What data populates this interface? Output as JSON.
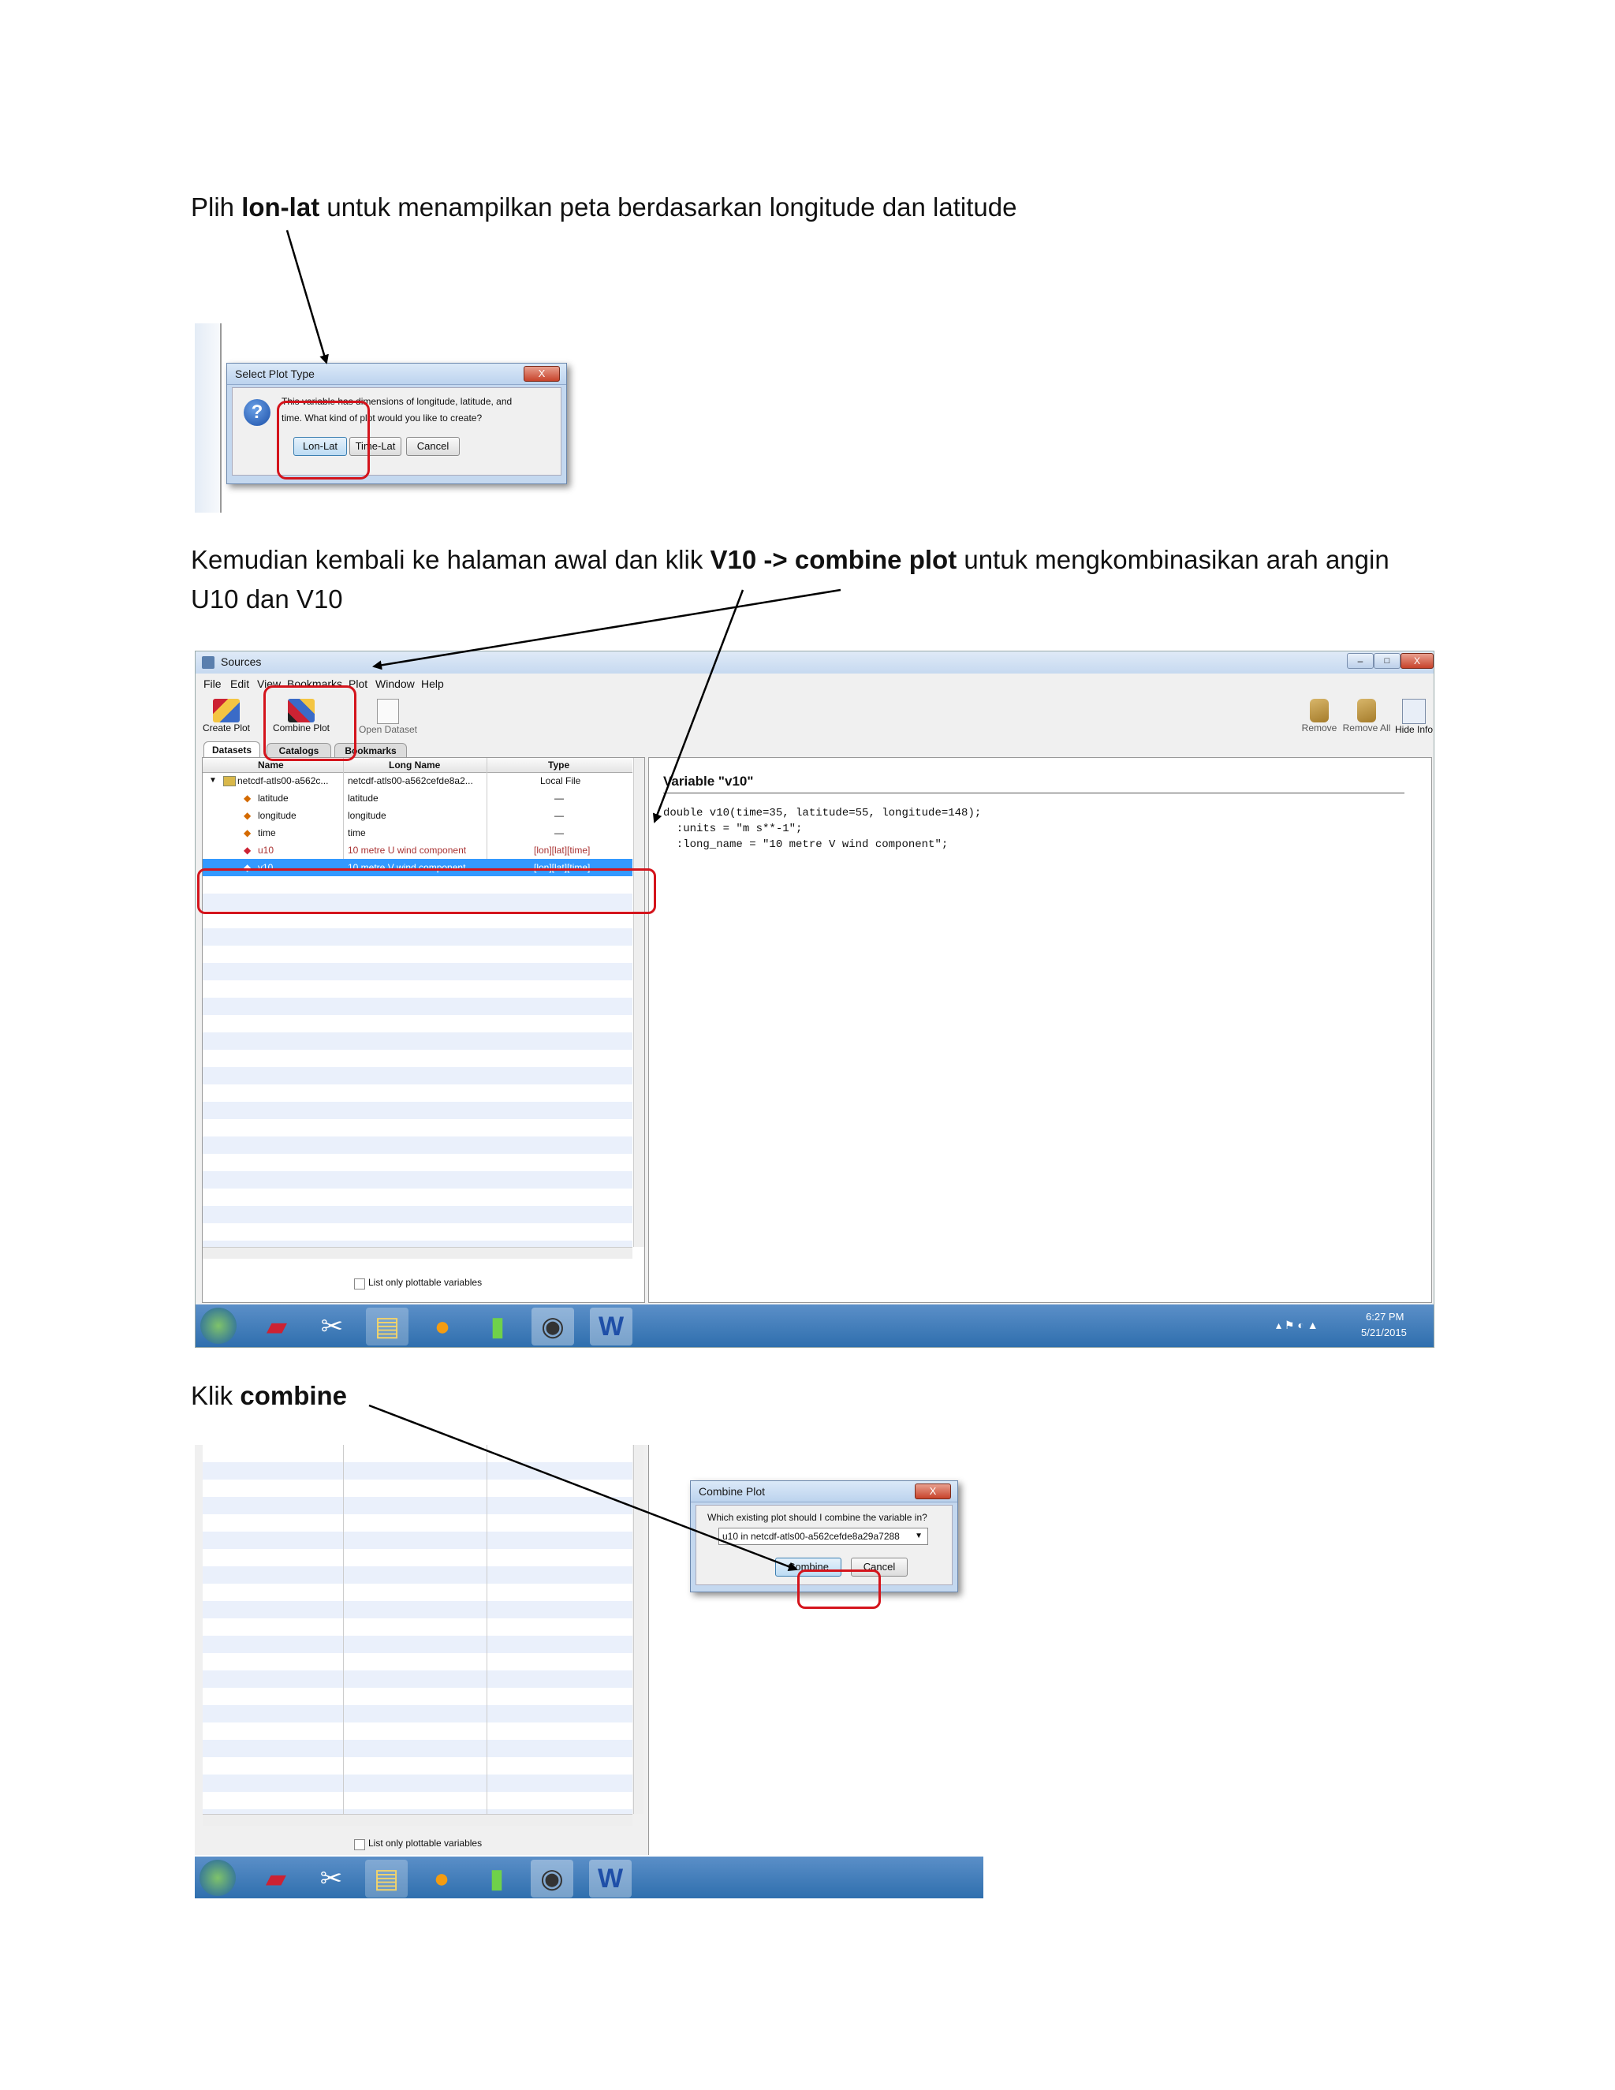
{
  "para1": {
    "pre": "Plih ",
    "bold": "lon-lat",
    "post": " untuk menampilkan peta berdasarkan longitude dan latitude"
  },
  "dialog1": {
    "title": "Select Plot Type",
    "close": "X",
    "message_line1": "This variable has dimensions of longitude, latitude, and",
    "message_line2": "time. What kind of plot would you like to create?",
    "btn_lonlat": "Lon-Lat",
    "btn_timelat": "Time-Lat",
    "btn_cancel": "Cancel"
  },
  "para2": {
    "pre": "Kemudian kembali ke halaman awal dan klik ",
    "bold1": "V10 -> combine plot",
    "post": " untuk mengkombinasikan arah angin",
    "line2": "U10 dan V10"
  },
  "app": {
    "title": "Sources",
    "menu": [
      "File",
      "Edit",
      "View",
      "Bookmarks",
      "Plot",
      "Window",
      "Help"
    ],
    "toolbar_left": [
      "Create Plot",
      "Combine Plot",
      "Open Dataset"
    ],
    "toolbar_right": [
      "Remove",
      "Remove All",
      "Hide Info"
    ],
    "tabs": [
      "Datasets",
      "Catalogs",
      "Bookmarks"
    ],
    "columns": [
      "Name",
      "Long Name",
      "Type"
    ],
    "rows": [
      {
        "name": "netcdf-atls00-a562c...",
        "long": "netcdf-atls00-a562cefde8a2...",
        "type": "Local File"
      },
      {
        "name": "latitude",
        "long": "latitude",
        "type": "—"
      },
      {
        "name": "longitude",
        "long": "longitude",
        "type": "—"
      },
      {
        "name": "time",
        "long": "time",
        "type": "—"
      },
      {
        "name": "u10",
        "long": "10 metre U wind component",
        "type": "[lon][lat][time]"
      },
      {
        "name": "v10",
        "long": "10 metre V wind component",
        "type": "[lon][lat][time]"
      }
    ],
    "checkbox_label": "List only plottable variables",
    "info_title": "Variable \"v10\"",
    "info_lines": [
      "double v10(time=35, latitude=55, longitude=148);",
      "  :units = \"m s**-1\";",
      "  :long_name = \"10 metre V wind component\";"
    ],
    "clock_time": "6:27 PM",
    "clock_date": "5/21/2015"
  },
  "para3": {
    "pre": "Klik ",
    "bold": "combine"
  },
  "dialog2": {
    "title": "Combine Plot",
    "close": "X",
    "question": "Which existing plot should I combine the variable in?",
    "select_value": "u10 in netcdf-atls00-a562cefde8a29a7288",
    "btn_combine": "Combine",
    "btn_cancel": "Cancel"
  },
  "app2": {
    "checkbox_label": "List only plottable variables"
  },
  "icons": {
    "help": "question-icon",
    "window_close": "close-icon"
  },
  "colors": {
    "annotation_red": "#d4141c",
    "selection_blue": "#3399ff",
    "taskbar": "#2f6fae"
  }
}
